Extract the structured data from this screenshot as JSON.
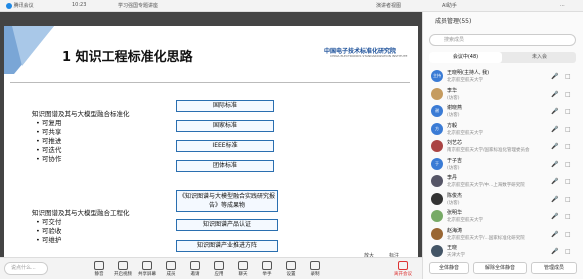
{
  "topbar": {
    "app": "腾讯会议",
    "time": "10:23",
    "meeting_title": "学习强国专题讲座",
    "view": "演讲者视图",
    "speaking": "正在讲话：",
    "rec": "录制中",
    "ai": "AI助手",
    "more": "..."
  },
  "slide": {
    "title": "1 知识工程标准化思路",
    "logo": "中国电子技术标准化研究院",
    "logo_sub": "CHINA ELECTRONICS STANDARDIZATION INSTITUTE",
    "left1_title": "知识图谱及其与大模型融合标准化",
    "left1_items": [
      "可复用",
      "可共享",
      "可推进",
      "可迭代",
      "可协作"
    ],
    "left2_title": "知识图谱及其与大模型融合工程化",
    "left2_items": [
      "可交付",
      "可验收",
      "可维护"
    ],
    "boxes": [
      "国际标准",
      "国家标准",
      "IEEE标准",
      "团体标准",
      "《知识图谱与大模型融合实践研究报告》等成果物",
      "知识图谱产品认证",
      "知识图谱产业推进方阵"
    ],
    "controls": [
      "放大",
      "标注"
    ]
  },
  "bottombar": {
    "chat_placeholder": "说点什么...",
    "buttons": [
      "静音",
      "开启视频",
      "共享屏幕",
      "成员",
      "邀请",
      "应用",
      "聊天",
      "举手",
      "设置",
      "录制",
      "离开会议"
    ]
  },
  "sidebar": {
    "title": "成员管理(55)",
    "search_placeholder": "搜索成员",
    "tabs": [
      "会议中(48)",
      "未入会"
    ],
    "members": [
      {
        "avatar": "主持",
        "name": "王晓明(主持人, 我)",
        "org": "北京航空航天大学",
        "color": "#3a7bd5"
      },
      {
        "avatar": "",
        "name": "李华",
        "org": "(访客)",
        "color": "#c59b5f"
      },
      {
        "avatar": "谢",
        "name": "谢晓燕",
        "org": "(访客)",
        "color": "#3a7bd5"
      },
      {
        "avatar": "方",
        "name": "方毅",
        "org": "北京航空航天大学",
        "color": "#3a7bd5"
      },
      {
        "avatar": "",
        "name": "刘艺芯",
        "org": "南京航空航天大学/国家标准化管理委员会",
        "color": "#a44"
      },
      {
        "avatar": "于",
        "name": "于子吉",
        "org": "(访客)",
        "color": "#3a7bd5"
      },
      {
        "avatar": "",
        "name": "李丹",
        "org": "北京航空航天大学/中...上海数字研究院",
        "color": "#556"
      },
      {
        "avatar": "",
        "name": "陈俊杰",
        "org": "(访客)",
        "color": "#333"
      },
      {
        "avatar": "",
        "name": "张明华",
        "org": "北京航空航天大学",
        "color": "#7a6"
      },
      {
        "avatar": "",
        "name": "赵海涛",
        "org": "北京航空航天大学/...国家标准化研究院",
        "color": "#963"
      },
      {
        "avatar": "",
        "name": "王晓",
        "org": "天津大学",
        "color": "#456"
      }
    ],
    "buttons": [
      "全体静音",
      "解除全体静音",
      "管理成员"
    ]
  }
}
